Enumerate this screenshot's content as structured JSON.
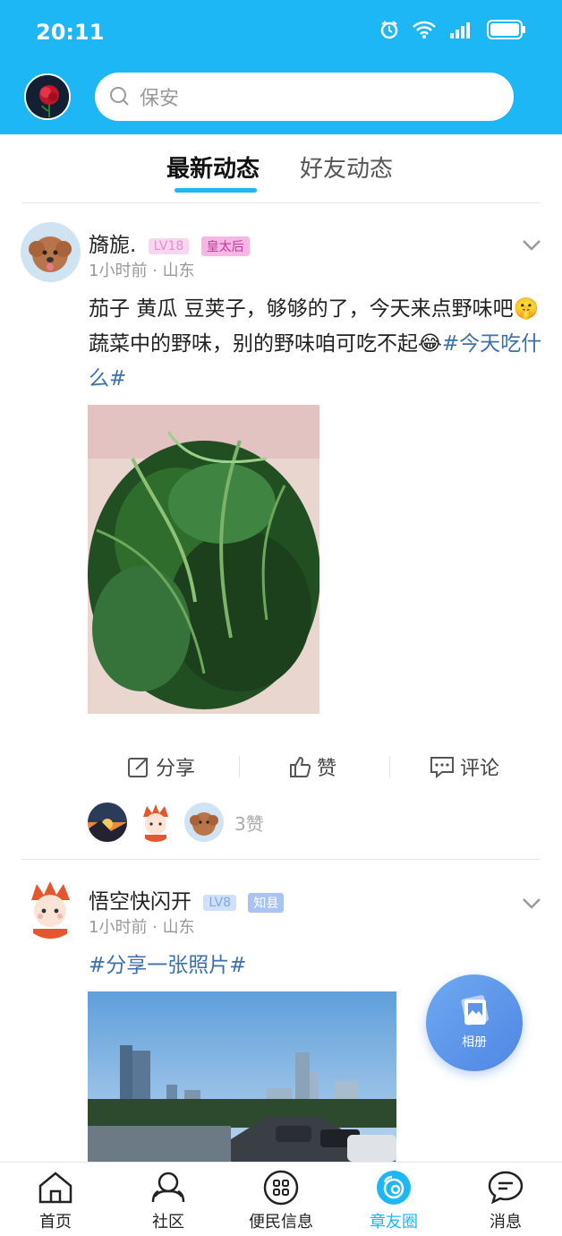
{
  "status_bar": {
    "time": "20:11"
  },
  "search": {
    "placeholder": "保安"
  },
  "tabs": [
    {
      "label": "最新动态",
      "active": true
    },
    {
      "label": "好友动态",
      "active": false
    }
  ],
  "posts": [
    {
      "author": "旖旎.",
      "level": "LV18",
      "title_badge": "皇太后",
      "time": "1小时前",
      "location": "山东",
      "text": "茄子 黄瓜  豆荚子，够够的了，今天来点野味吧🤫蔬菜中的野味，别的野味咱可吃不起😂",
      "topic": "#今天吃什么#",
      "actions": {
        "share": "分享",
        "like": "赞",
        "comment": "评论"
      },
      "like_count": "3赞"
    },
    {
      "author": "悟空快闪开",
      "level": "LV8",
      "title_badge": "知县",
      "time": "1小时前",
      "location": "山东",
      "topic": "#分享一张照片#"
    }
  ],
  "fab": {
    "label": "相册"
  },
  "bottom_nav": [
    {
      "label": "首页",
      "icon": "home-icon"
    },
    {
      "label": "社区",
      "icon": "community-icon"
    },
    {
      "label": "便民信息",
      "icon": "grid-icon"
    },
    {
      "label": "章友圈",
      "icon": "circle-icon",
      "active": true
    },
    {
      "label": "消息",
      "icon": "message-icon"
    }
  ],
  "colors": {
    "accent": "#1EB7F5",
    "topic": "#3d6fa8"
  }
}
